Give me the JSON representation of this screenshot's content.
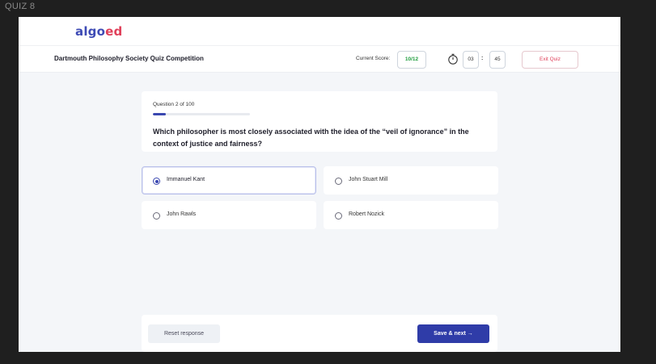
{
  "window_label": "QUIZ 8",
  "brand": {
    "part1": "algo",
    "part2": "ed",
    "color_primary": "#3e4bb5",
    "color_accent": "#e0405a"
  },
  "header": {
    "competition_title": "Dartmouth Philosophy Society Quiz Competition",
    "score_label": "Current Score:",
    "score_value": "10/12",
    "timer_icon": "stopwatch-icon",
    "timer_minutes": "03",
    "timer_separator": ":",
    "timer_seconds": "45",
    "exit_label": "Exit Quiz"
  },
  "question": {
    "counter": "Question 2 of 100",
    "progress_fraction": 0.13,
    "text": "Which philosopher is most closely associated with the idea of the “veil of ignorance” in the context of justice and fairness?"
  },
  "options": [
    {
      "label": "Immanuel Kant",
      "selected": true
    },
    {
      "label": "John Stuart Mill",
      "selected": false
    },
    {
      "label": "John Rawls",
      "selected": false
    },
    {
      "label": "Robert Nozick",
      "selected": false
    }
  ],
  "footer": {
    "reset_label": "Reset response",
    "save_label": "Save & next →"
  },
  "colors": {
    "score_green": "#1f9d3e",
    "primary_button": "#2f3ca8",
    "exit_red": "#e0405a"
  }
}
